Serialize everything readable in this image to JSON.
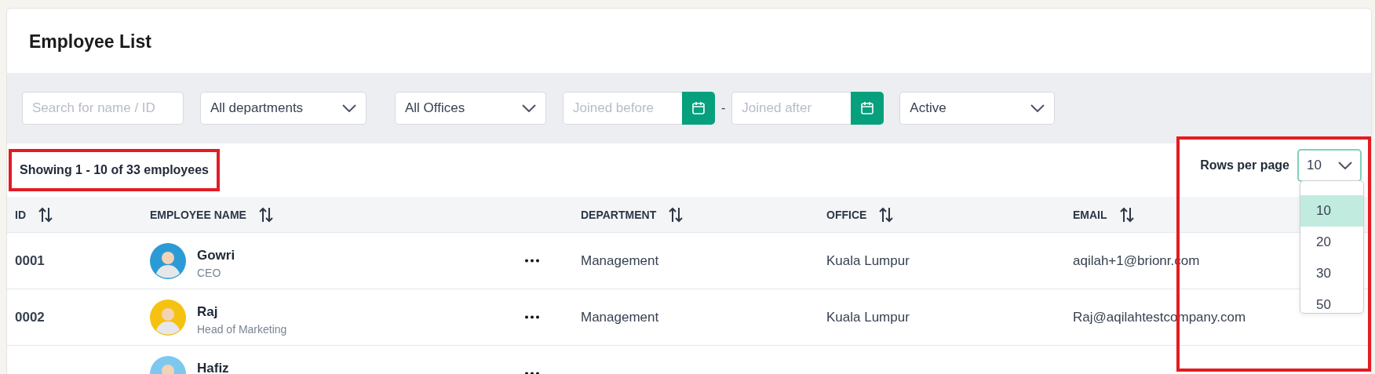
{
  "title": "Employee List",
  "filters": {
    "search": {
      "placeholder": "Search for name / ID"
    },
    "department": {
      "value": "All departments"
    },
    "office": {
      "value": "All Offices"
    },
    "joined_before": {
      "placeholder": "Joined before"
    },
    "separator": "-",
    "joined_after": {
      "placeholder": "Joined after"
    },
    "status": {
      "value": "Active"
    }
  },
  "summary": {
    "text": "Showing 1 - 10 of 33 employees",
    "highlighted": true
  },
  "rows_per_page": {
    "label": "Rows per page",
    "value": "10",
    "expanded": true,
    "highlighted": true,
    "options": [
      {
        "label": "10",
        "selected": true
      },
      {
        "label": "20",
        "selected": false
      },
      {
        "label": "30",
        "selected": false
      },
      {
        "label": "50",
        "selected": false
      }
    ]
  },
  "table": {
    "columns": [
      "ID",
      "EMPLOYEE NAME",
      "DEPARTMENT",
      "OFFICE",
      "EMAIL"
    ],
    "rows": [
      {
        "id": "0001",
        "name": "Gowri",
        "role": "CEO",
        "color": "#2b9bd6",
        "department": "Management",
        "office": "Kuala Lumpur",
        "email": "aqilah+1@brionr.com"
      },
      {
        "id": "0002",
        "name": "Raj",
        "role": "Head of Marketing",
        "color": "#f5c211",
        "department": "Management",
        "office": "Kuala Lumpur",
        "email": "Raj@aqilahtestcompany.com"
      },
      {
        "name": "Hafiz",
        "color": "#7cc8ef"
      }
    ]
  }
}
